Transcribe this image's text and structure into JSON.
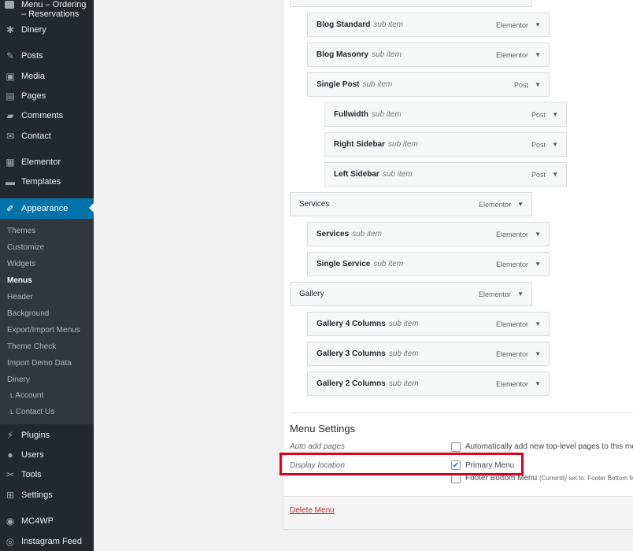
{
  "sidebar": {
    "top_label": "Menu – Ordering – Reservations",
    "items": [
      {
        "label": "Dinery",
        "icon": "gear-icon",
        "glyph": "✱"
      },
      {
        "label": "Posts",
        "icon": "pin-icon",
        "glyph": "✎"
      },
      {
        "label": "Media",
        "icon": "media-icon",
        "glyph": "▣"
      },
      {
        "label": "Pages",
        "icon": "pages-icon",
        "glyph": "▤"
      },
      {
        "label": "Comments",
        "icon": "comment-icon",
        "glyph": "▰"
      },
      {
        "label": "Contact",
        "icon": "envelope-icon",
        "glyph": "✉"
      },
      {
        "label": "Elementor",
        "icon": "elementor-icon",
        "glyph": "▦"
      },
      {
        "label": "Templates",
        "icon": "folder-icon",
        "glyph": "▬"
      },
      {
        "label": "Appearance",
        "icon": "brush-icon",
        "glyph": "✐"
      },
      {
        "label": "Plugins",
        "icon": "plug-icon",
        "glyph": "⚡"
      },
      {
        "label": "Users",
        "icon": "user-icon",
        "glyph": "●"
      },
      {
        "label": "Tools",
        "icon": "wrench-icon",
        "glyph": "✂"
      },
      {
        "label": "Settings",
        "icon": "settings-icon",
        "glyph": "⊞"
      },
      {
        "label": "MC4WP",
        "icon": "mc4wp-icon",
        "glyph": "◉"
      },
      {
        "label": "Instagram Feed",
        "icon": "instagram-icon",
        "glyph": "◎"
      }
    ],
    "submenu": [
      {
        "label": "Themes"
      },
      {
        "label": "Customize"
      },
      {
        "label": "Widgets"
      },
      {
        "label": "Menus"
      },
      {
        "label": "Header"
      },
      {
        "label": "Background"
      },
      {
        "label": "Export/Import Menus"
      },
      {
        "label": "Theme Check"
      },
      {
        "label": "Import Demo Data"
      },
      {
        "label": "Dinery"
      },
      {
        "label": "ʟ Account"
      },
      {
        "label": "ʟ Contact Us"
      }
    ]
  },
  "menu_items": [
    {
      "title": "Blog Standard",
      "sub": "sub item",
      "type": "Elementor"
    },
    {
      "title": "Blog Masonry",
      "sub": "sub item",
      "type": "Elementor"
    },
    {
      "title": "Single Post",
      "sub": "sub item",
      "type": "Post"
    },
    {
      "title": "Fullwidth",
      "sub": "sub item",
      "type": "Post"
    },
    {
      "title": "Right Sidebar",
      "sub": "sub item",
      "type": "Post"
    },
    {
      "title": "Left Sidebar",
      "sub": "sub item",
      "type": "Post"
    },
    {
      "title": "Services",
      "sub": "",
      "type": "Elementor"
    },
    {
      "title": "Services",
      "sub": "sub item",
      "type": "Elementor"
    },
    {
      "title": "Single Service",
      "sub": "sub item",
      "type": "Elementor"
    },
    {
      "title": "Gallery",
      "sub": "",
      "type": "Elementor"
    },
    {
      "title": "Gallery 4 Columns",
      "sub": "sub item",
      "type": "Elementor"
    },
    {
      "title": "Gallery 3 Columns",
      "sub": "sub item",
      "type": "Elementor"
    },
    {
      "title": "Gallery 2 Columns",
      "sub": "sub item",
      "type": "Elementor"
    }
  ],
  "menu_settings": {
    "title": "Menu Settings",
    "auto_add_label": "Auto add pages",
    "auto_add_option": "Automatically add new top-level pages to this me",
    "display_location_label": "Display location",
    "primary_menu": "Primary Menu",
    "footer_bottom": "Footer Bottom Menu",
    "footer_note": "(Currently set to: Footer Bottom M"
  },
  "delete_menu": "Delete Menu",
  "colors": {
    "highlight": "#e0001b",
    "active_menu": "#0073aa"
  }
}
